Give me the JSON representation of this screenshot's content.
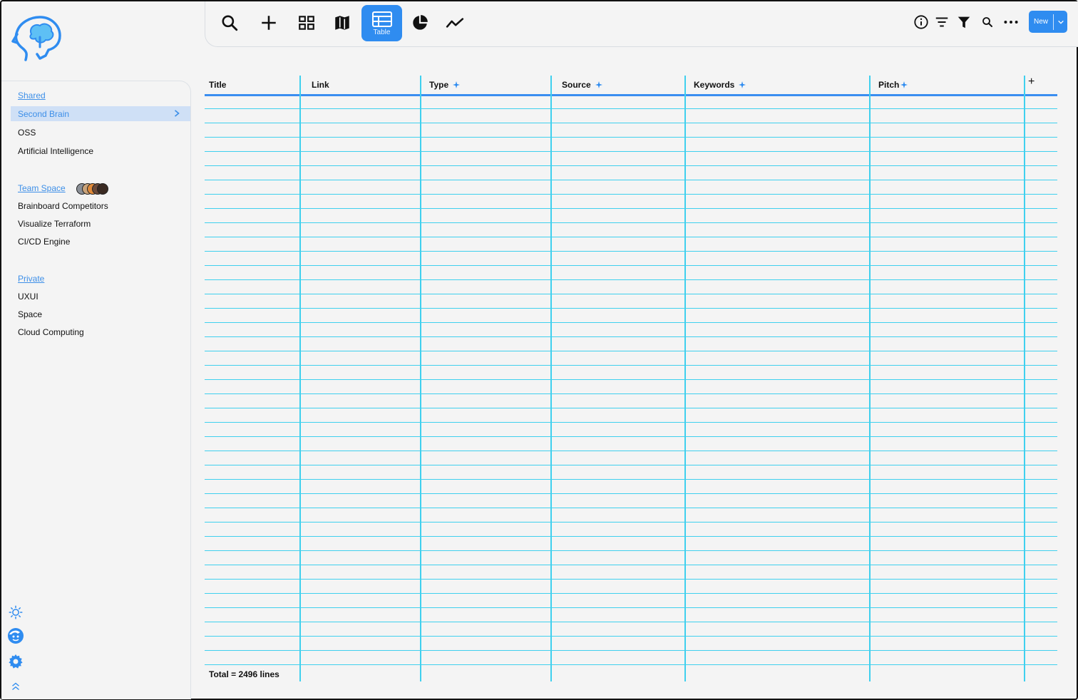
{
  "toolbar": {
    "buttons": [
      {
        "name": "search-icon"
      },
      {
        "name": "add-icon"
      },
      {
        "name": "grid-view-icon"
      },
      {
        "name": "map-view-icon"
      },
      {
        "name": "table-view-icon",
        "label": "Table",
        "active": true
      },
      {
        "name": "pie-chart-icon"
      },
      {
        "name": "line-chart-icon"
      }
    ],
    "right_icons": [
      "info-icon",
      "sort-icon",
      "filter-icon",
      "search-small-icon",
      "more-icon"
    ],
    "new_label": "New"
  },
  "sidebar": {
    "shared_label": "Shared",
    "shared_items": [
      "Second Brain",
      "OSS",
      "Artificial Intelligence"
    ],
    "team_label": "Team Space",
    "team_items": [
      "Brainboard Competitors",
      "Visualize Terraform",
      "CI/CD Engine"
    ],
    "private_label": "Private",
    "private_items": [
      "UXUI",
      "Space",
      "Cloud Computing"
    ],
    "bottom_icons": [
      "sun-icon",
      "face-icon",
      "gear-icon",
      "chevrons-up-icon"
    ]
  },
  "table": {
    "columns": [
      {
        "label": "Title",
        "ai": false
      },
      {
        "label": "Link",
        "ai": false
      },
      {
        "label": "Type",
        "ai": true
      },
      {
        "label": "Source",
        "ai": true
      },
      {
        "label": "Keywords",
        "ai": true
      },
      {
        "label": "Pitch",
        "ai": true
      }
    ],
    "add_column_label": "+",
    "total_label": "Total = 2496 lines"
  },
  "colors": {
    "accent": "#2f8cf0",
    "grid": "#3fd0ee",
    "selected_bg": "#cfe0f6",
    "link": "#3d8fe8"
  }
}
